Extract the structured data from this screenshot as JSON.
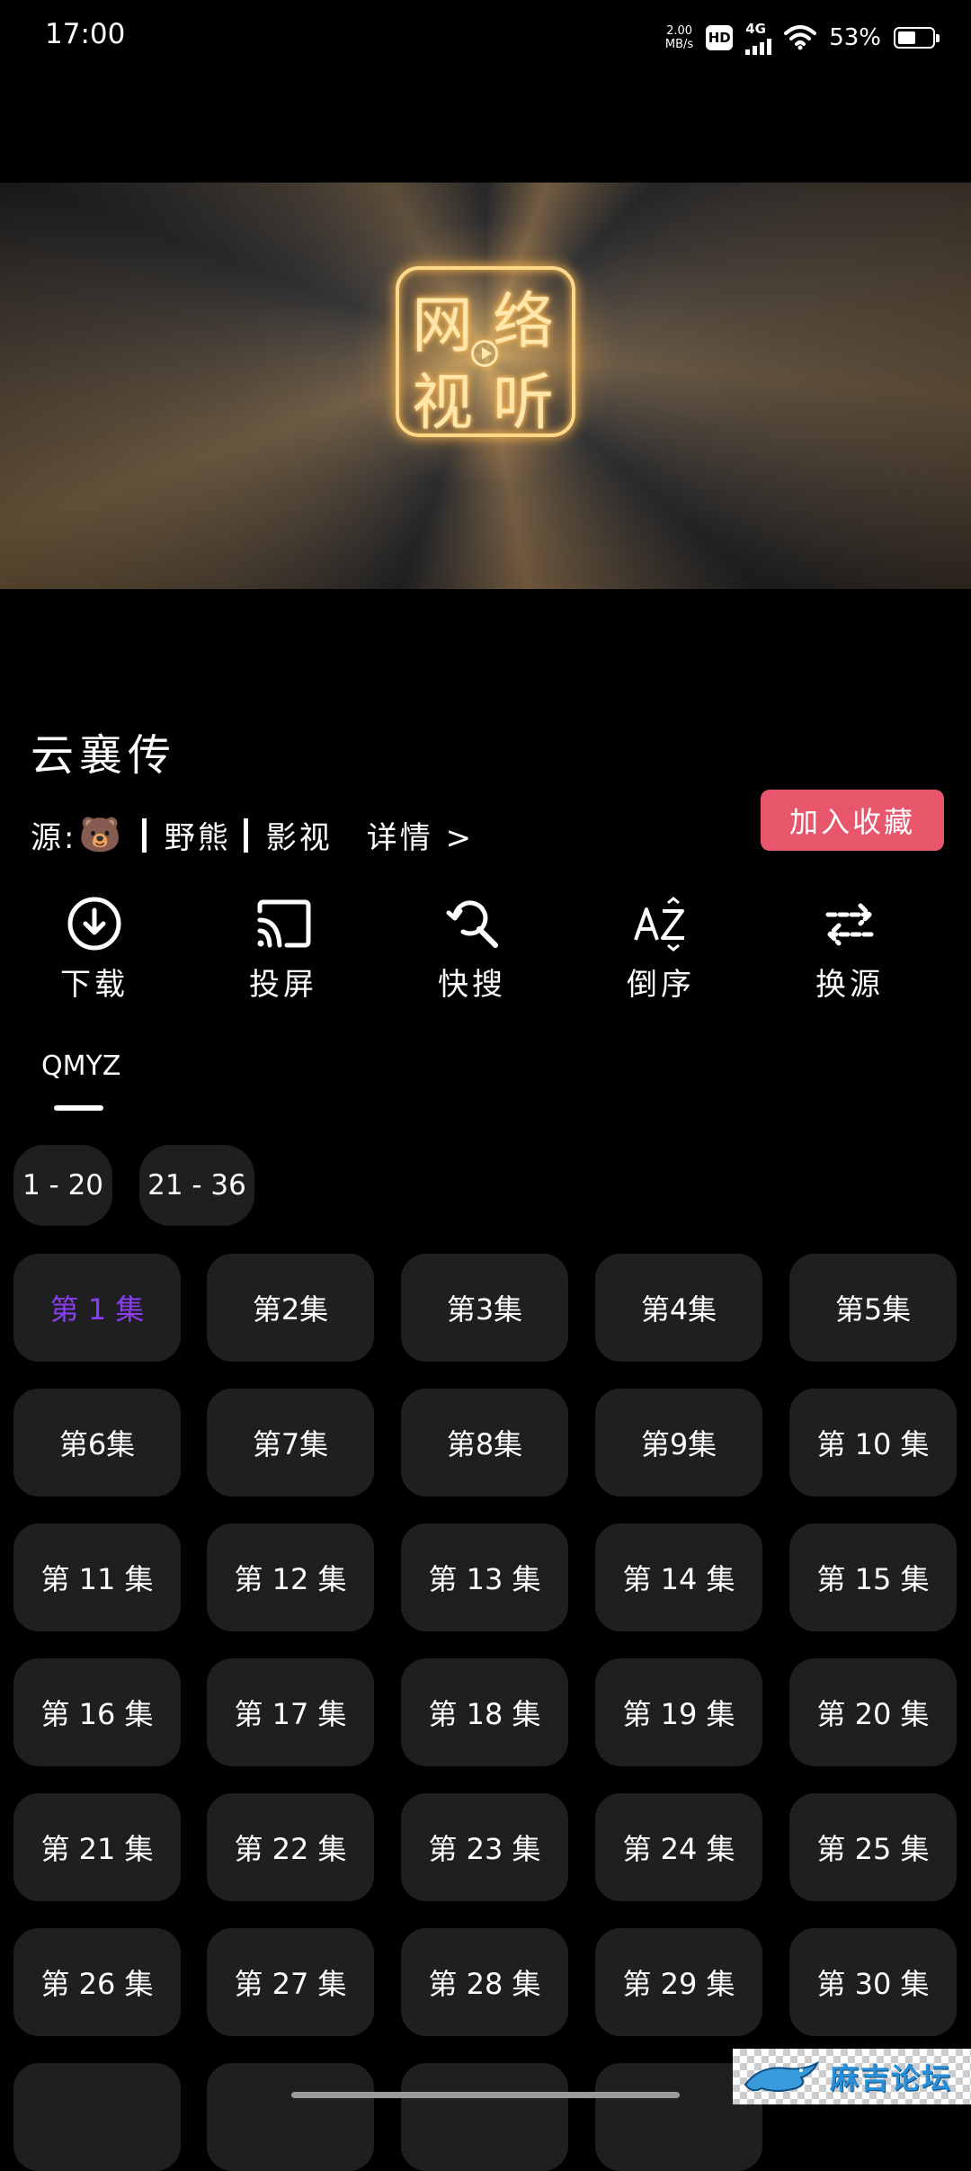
{
  "status_bar": {
    "time": "17:00",
    "net_speed_value": "2.00",
    "net_speed_unit": "MB/s",
    "hd_label": "HD",
    "network_label": "4G",
    "battery_percent": "53%",
    "battery_level": 0.53
  },
  "video": {
    "logo_chars": [
      "网",
      "络",
      "视",
      "听"
    ],
    "logo_icon": "play-icon"
  },
  "show": {
    "title": "云襄传",
    "source_prefix": "源:",
    "source_emoji": "🐻",
    "source_name": "野熊",
    "source_type": "影视",
    "details_link": "详情 >",
    "favorite_button": "加入收藏",
    "favorite_color": "#e8566b"
  },
  "actions": [
    {
      "label": "下载",
      "icon": "download-icon"
    },
    {
      "label": "投屏",
      "icon": "cast-icon"
    },
    {
      "label": "快搜",
      "icon": "quick-search-icon"
    },
    {
      "label": "倒序",
      "icon": "sort-reverse-icon"
    },
    {
      "label": "换源",
      "icon": "switch-source-icon"
    }
  ],
  "tabs": [
    {
      "label": "QMYZ",
      "active": true
    }
  ],
  "ranges": [
    "1 - 20",
    "21 - 36"
  ],
  "episodes": {
    "active_index": 0,
    "active_color": "#8a3ff0",
    "items": [
      "第 1 集",
      "第2集",
      "第3集",
      "第4集",
      "第5集",
      "第6集",
      "第7集",
      "第8集",
      "第9集",
      "第 10 集",
      "第 11 集",
      "第 12 集",
      "第 13 集",
      "第 14 集",
      "第 15 集",
      "第 16 集",
      "第 17 集",
      "第 18 集",
      "第 19 集",
      "第 20 集",
      "第 21 集",
      "第 22 集",
      "第 23 集",
      "第 24 集",
      "第 25 集",
      "第 26 集",
      "第 27 集",
      "第 28 集",
      "第 29 集",
      "第 30 集",
      "",
      "",
      "",
      ""
    ]
  },
  "watermark": {
    "text": "麻吉论坛"
  }
}
